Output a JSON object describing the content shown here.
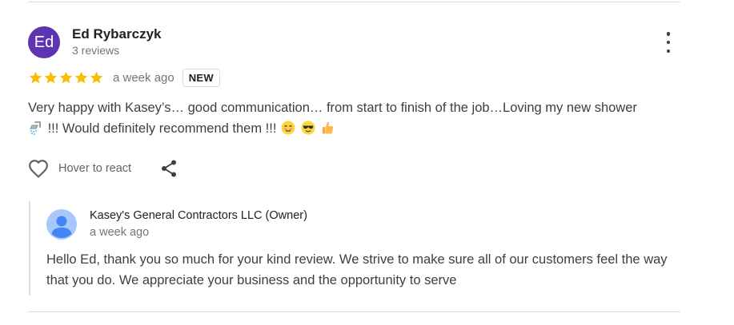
{
  "review": {
    "avatar_initials": "Ed",
    "avatar_color": "#5e35b1",
    "reviewer_name": "Ed Rybarczyk",
    "review_count": "3 reviews",
    "rating": 5,
    "rating_max": 5,
    "star_color": "#fbbc04",
    "date": "a week ago",
    "badge": "NEW",
    "text_line1": "Very happy with Kasey’s… good communication… from start to finish of the job…Loving my new shower",
    "text_line2": "!!! Would definitely recommend them !!!",
    "emoji_icons": [
      "shower-icon",
      "smiling-face-icon",
      "sunglasses-face-icon",
      "thumbs-up-icon"
    ]
  },
  "actions": {
    "react_label": "Hover to react",
    "icons": [
      "heart-icon",
      "share-icon"
    ]
  },
  "owner_reply": {
    "name": "Kasey's General Contractors LLC (Owner)",
    "date": "a week ago",
    "text": "Hello Ed, thank you so much for your kind review. We strive to make sure all of our customers feel the way that you do. We appreciate your business and the opportunity to serve",
    "avatar_color": "#a8c7fa"
  }
}
